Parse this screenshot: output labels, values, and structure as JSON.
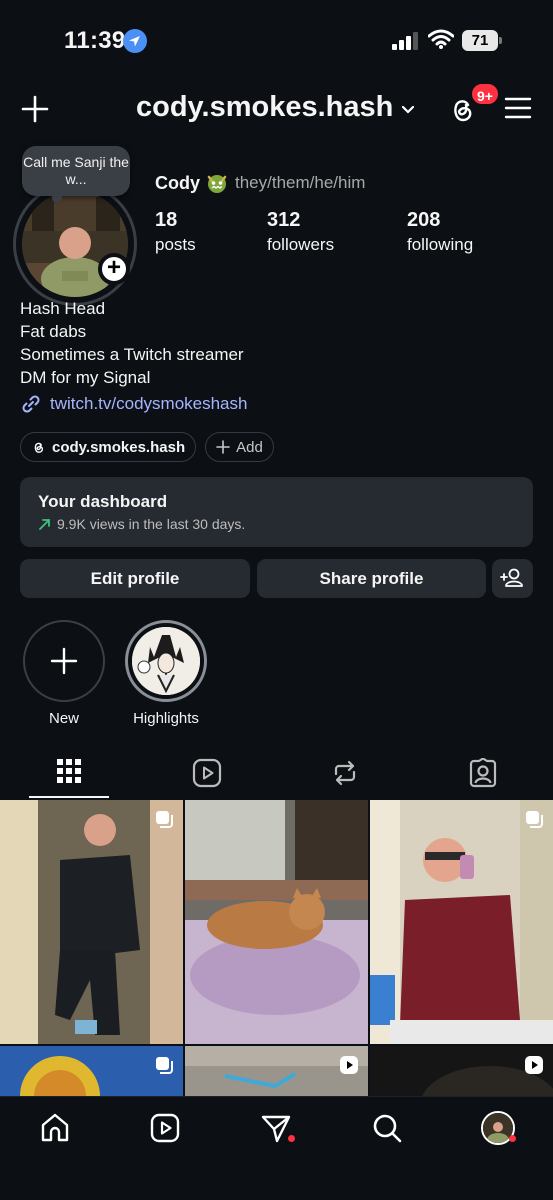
{
  "status_bar": {
    "time": "11:39",
    "battery": "71"
  },
  "header": {
    "username": "cody.smokes.hash",
    "notification_count": "9+"
  },
  "profile": {
    "note": "Call me Sanji the w...",
    "display_name": "Cody",
    "pronouns": "they/them/he/him",
    "stats": [
      {
        "value": "18",
        "label": "posts"
      },
      {
        "value": "312",
        "label": "followers"
      },
      {
        "value": "208",
        "label": "following"
      }
    ],
    "bio": [
      "Hash Head",
      "Fat dabs",
      "Sometimes a Twitch streamer",
      "DM for my Signal"
    ],
    "link": "twitch.tv/codysmokeshash",
    "threads_chip": "cody.smokes.hash",
    "add_chip": "Add"
  },
  "dashboard": {
    "title": "Your dashboard",
    "subtitle": "9.9K views in the last 30 days."
  },
  "actions": {
    "edit": "Edit profile",
    "share": "Share profile"
  },
  "highlights": [
    {
      "label": "New"
    },
    {
      "label": "Highlights"
    }
  ],
  "tabs": [
    "posts-grid-icon",
    "reels-icon",
    "reposts-icon",
    "tagged-icon"
  ],
  "colors": {
    "background": "#0c1014",
    "surface": "#262a31",
    "link": "#a5b5ff",
    "badge": "#ff3040"
  }
}
